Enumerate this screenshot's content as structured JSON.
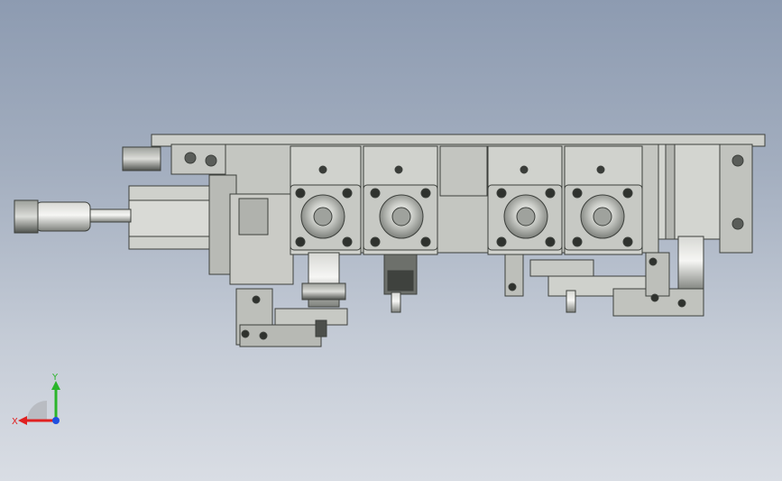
{
  "view": {
    "background_top": "#8d9bb1",
    "background_bottom": "#d9dde4",
    "part_fill": "#c9cbc6",
    "part_dark": "#6e716c",
    "part_light": "#e4e5e1"
  },
  "triad": {
    "x_label": "X",
    "y_label": "Y",
    "x_color": "#e02020",
    "y_color": "#2bb52b",
    "z_color": "#2050e0"
  }
}
